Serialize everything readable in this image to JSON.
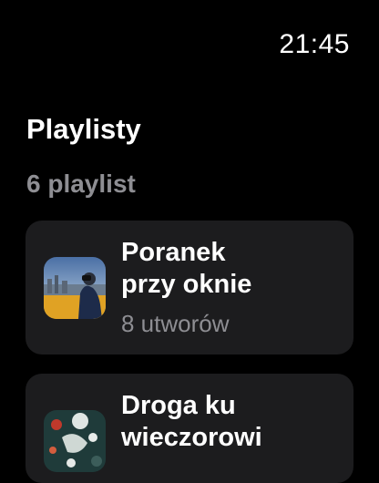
{
  "status": {
    "time": "21:45"
  },
  "header": {
    "title": "Playlisty",
    "count_label": "6 playlist"
  },
  "playlists": [
    {
      "title_line1": "Poranek",
      "title_line2": "przy oknie",
      "tracks": "8 utworów",
      "artwork": "window-morning-artwork"
    },
    {
      "title_line1": "Droga ku",
      "title_line2": "wieczorowi",
      "tracks": "",
      "artwork": "evening-road-artwork"
    }
  ],
  "colors": {
    "background": "#000000",
    "card": "#1c1c1e",
    "secondary_text": "#8e8e93"
  }
}
